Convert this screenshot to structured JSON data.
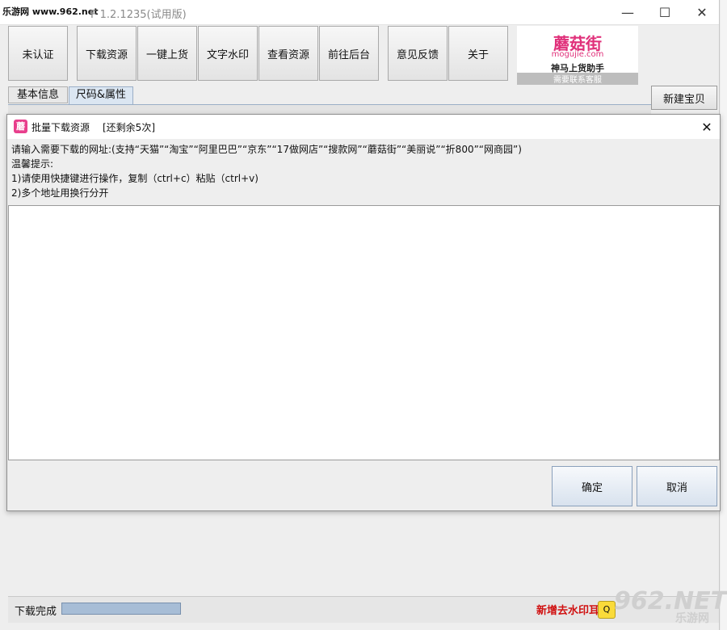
{
  "window": {
    "watermark_site": "乐游网 www.962.net",
    "title": "F 1.2.1235(试用版)",
    "min_glyph": "—",
    "max_glyph": "☐",
    "close_glyph": "✕"
  },
  "toolbar": {
    "buttons": [
      "未认证",
      "下载资源",
      "一键上货",
      "文字水印",
      "查看资源",
      "前往后台",
      "意见反馈",
      "关于"
    ]
  },
  "banner": {
    "brand": "蘑菇街",
    "url": "mogujie.com",
    "slogan": "神马上货助手",
    "contact": "需要联系客服"
  },
  "tabs": [
    "基本信息",
    "尺码&属性"
  ],
  "new_item_button": "新建宝贝",
  "dialog": {
    "icon_glyph": "蘑",
    "title": "批量下载资源",
    "remaining": "[还剩余5次]",
    "close_glyph": "✕",
    "instructions": [
      "请输入需要下载的网址:(支持“天猫”“淘宝”“阿里巴巴”“京东”“17做网店”“搜款网”“蘑菇街”“美丽说”“折800”“网商园”)",
      "温馨提示:",
      "1)请使用快捷键进行操作，复制（ctrl+c）粘贴（ctrl+v)",
      "2)多个地址用换行分开"
    ],
    "url_input_value": "",
    "ok": "确定",
    "cancel": "取消"
  },
  "status": {
    "text": "下载完成",
    "progress": 1.0,
    "promo": "新增去水印耳",
    "qq_glyph": "Q"
  },
  "site_watermark": {
    "big": "962.NET",
    "small": "乐游网"
  },
  "colors": {
    "accent_pink": "#e0307a",
    "promo_red": "#d01010",
    "button_blue_border": "#8aa0bb"
  }
}
